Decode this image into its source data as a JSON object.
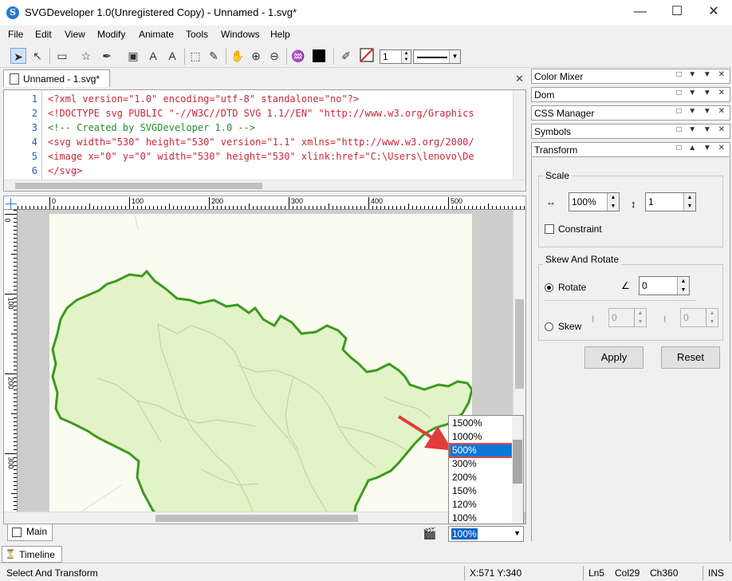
{
  "window": {
    "title": "SVGDeveloper 1.0(Unregistered Copy) - Unnamed - 1.svg*",
    "app_icon_letter": "S",
    "minimize": "—",
    "maximize": "☐",
    "close": "✕"
  },
  "menu": [
    "File",
    "Edit",
    "View",
    "Modify",
    "Animate",
    "Tools",
    "Windows",
    "Help"
  ],
  "toolbar": {
    "stroke_width_value": "1"
  },
  "editor": {
    "tab_label": "Unnamed - 1.svg*",
    "close_label": "✕",
    "lines": [
      {
        "num": "1",
        "text": "<?xml version=\"1.0\" encoding=\"utf-8\" standalone=\"no\"?>"
      },
      {
        "num": "2",
        "text": "<!DOCTYPE svg PUBLIC \"-//W3C//DTD SVG 1.1//EN\" \"http://www.w3.org/Graphics"
      },
      {
        "num": "3",
        "text": "<!-- Created by SVGDeveloper 1.0 -->"
      },
      {
        "num": "4",
        "text": "<svg width=\"530\" height=\"530\" version=\"1.1\" xmlns=\"http://www.w3.org/2000/"
      },
      {
        "num": "5",
        "text": "<image x=\"0\" y=\"0\" width=\"530\" height=\"530\" xlink:href=\"C:\\Users\\lenovo\\De"
      },
      {
        "num": "6",
        "text": "</svg>"
      }
    ]
  },
  "ruler": {
    "top_labels": [
      "0",
      "100",
      "200",
      "300",
      "400",
      "500"
    ],
    "left_labels": [
      "0",
      "100",
      "200",
      "300"
    ]
  },
  "canvas": {
    "main_tab": "Main",
    "zoom_current": "100%",
    "zoom_options": [
      "1500%",
      "1000%",
      "500%",
      "300%",
      "200%",
      "150%",
      "120%",
      "100%"
    ],
    "zoom_highlighted": "500%"
  },
  "timeline_tab": "Timeline",
  "status": {
    "message": "Select And Transform",
    "coords": "X:571  Y:340",
    "line": "Ln5",
    "col": "Col29",
    "char": "Ch360",
    "mode": "INS"
  },
  "panels": {
    "color_mixer": "Color Mixer",
    "dom": "Dom",
    "css_manager": "CSS Manager",
    "symbols": "Symbols",
    "transform": "Transform",
    "header_icons": "□ ▼ ▼ ✕",
    "header_icons_transform": "□ ▲ ▼ ✕"
  },
  "transform": {
    "scale_label": "Scale",
    "scale_x": "100%",
    "scale_y": "1",
    "constraint_label": "Constraint",
    "skew_rotate_label": "Skew And Rotate",
    "rotate_label": "Rotate",
    "rotate_value": "0",
    "skew_label": "Skew",
    "skew_x": "0",
    "skew_y": "0",
    "apply_label": "Apply",
    "reset_label": "Reset"
  }
}
